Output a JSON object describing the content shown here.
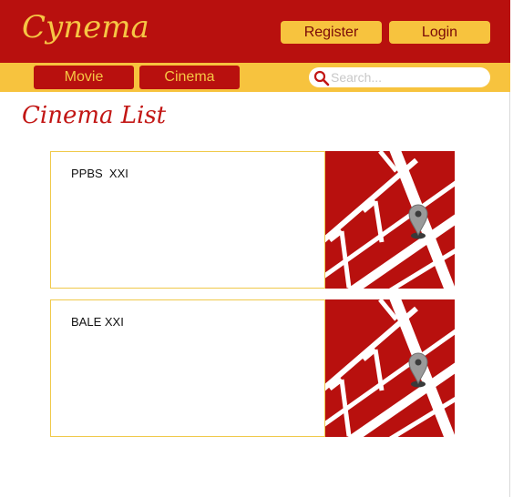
{
  "header": {
    "logo": "Cynema",
    "register_label": "Register",
    "login_label": "Login"
  },
  "nav": {
    "tabs": [
      {
        "label": "Movie"
      },
      {
        "label": "Cinema"
      }
    ],
    "search": {
      "placeholder": "Search...",
      "value": ""
    }
  },
  "main": {
    "title": "Cinema List",
    "cinemas": [
      {
        "name": "PPBS  XXI",
        "map_icon": "map-pin-icon"
      },
      {
        "name": "BALE XXI",
        "map_icon": "map-pin-icon"
      }
    ]
  },
  "colors": {
    "primary_red": "#b8100e",
    "accent_yellow": "#f7c33e",
    "title_red": "#c21614"
  }
}
